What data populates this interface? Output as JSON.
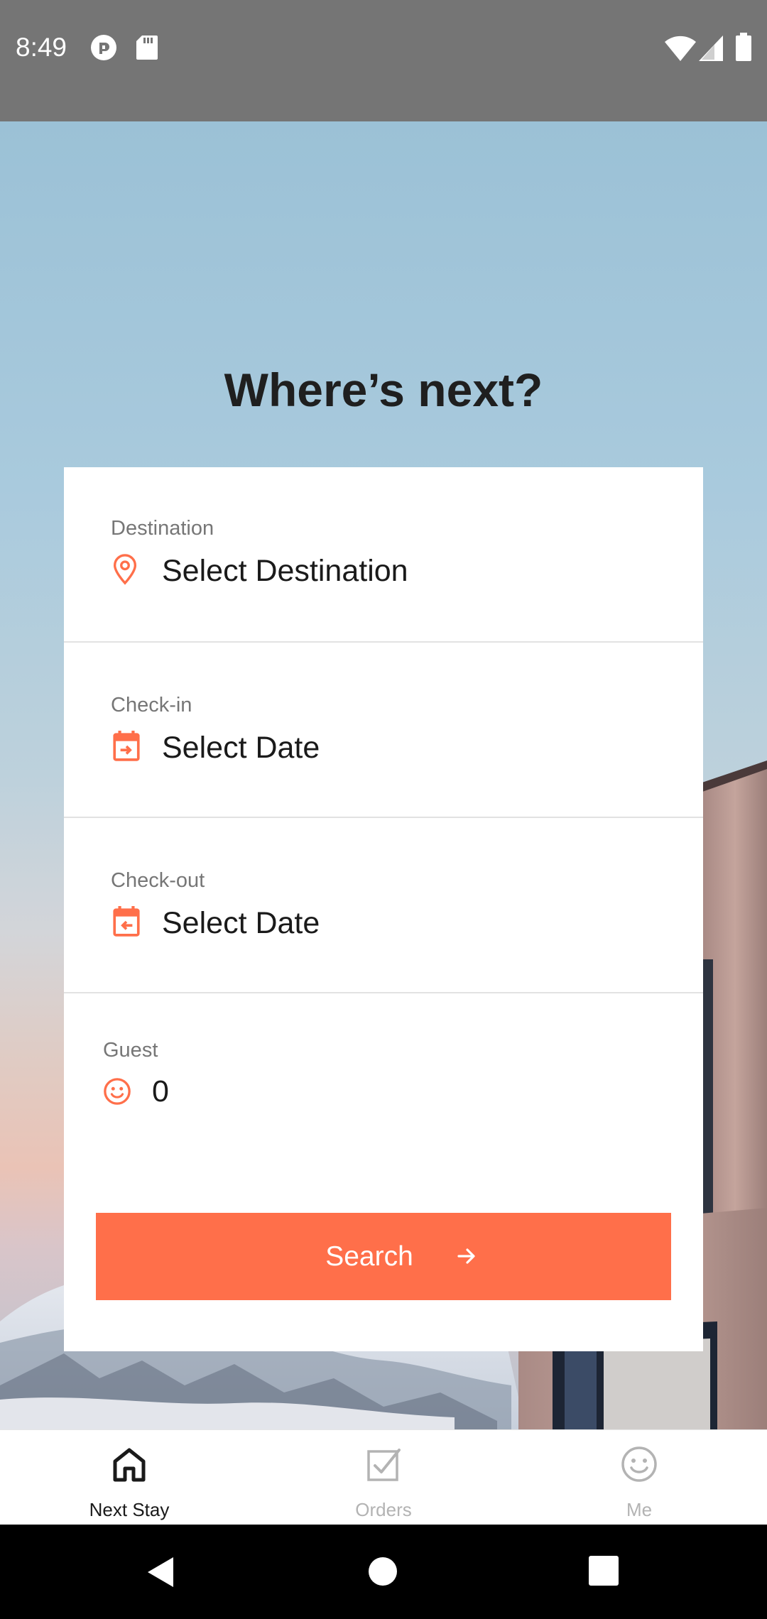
{
  "status_bar": {
    "time": "8:49",
    "icons": [
      "pocket-casts-icon",
      "sd-card-icon",
      "wifi-icon",
      "cell-signal-icon",
      "battery-icon"
    ]
  },
  "hero": {
    "title": "Where’s next?"
  },
  "form": {
    "destination": {
      "label": "Destination",
      "value": "Select Destination",
      "icon": "location-pin-icon"
    },
    "check_in": {
      "label": "Check-in",
      "value": "Select Date",
      "icon": "calendar-check-in-icon"
    },
    "check_out": {
      "label": "Check-out",
      "value": "Select Date",
      "icon": "calendar-check-out-icon"
    },
    "guest": {
      "label": "Guest",
      "value": "0",
      "icon": "smiley-icon"
    },
    "search_label": "Search"
  },
  "bottom_nav": {
    "items": [
      {
        "label": "Next Stay",
        "icon": "home-icon",
        "active": true
      },
      {
        "label": "Orders",
        "icon": "checkbox-icon",
        "active": false
      },
      {
        "label": "Me",
        "icon": "smiley-icon",
        "active": false
      }
    ]
  },
  "colors": {
    "accent": "#ff6f4a",
    "status_bar": "#757575",
    "title_text": "#1f1f1f",
    "inactive_nav": "#b3b3b3"
  }
}
